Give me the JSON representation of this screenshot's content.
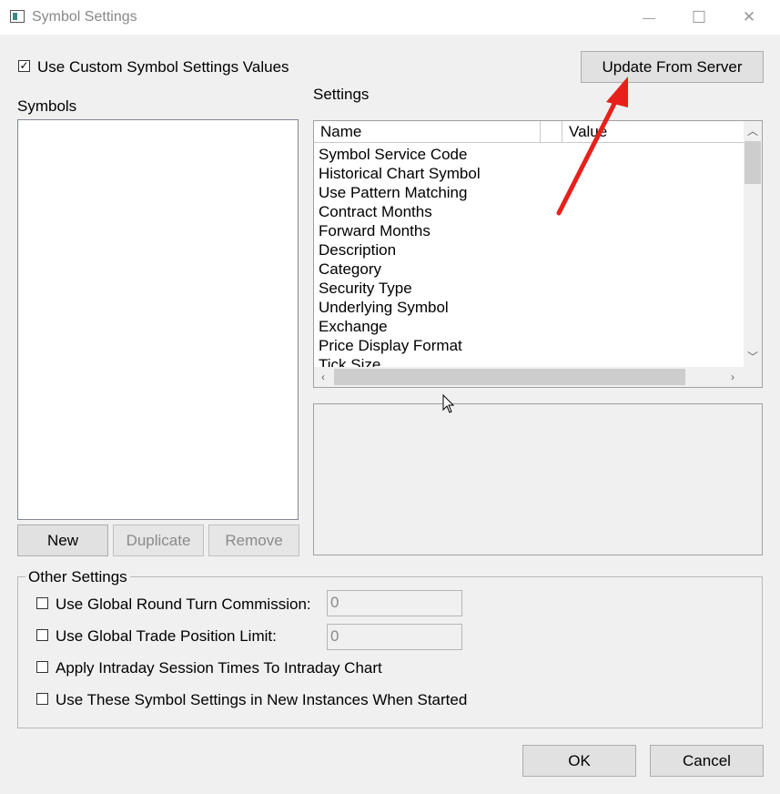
{
  "window": {
    "title": "Symbol Settings",
    "minimize_glyph": "—",
    "maximize_glyph": "☐",
    "close_glyph": "✕"
  },
  "use_custom": {
    "label": "Use Custom Symbol Settings Values",
    "checked": true,
    "mark": "✓"
  },
  "update_button": "Update From Server",
  "symbols": {
    "heading": "Symbols",
    "items": [],
    "buttons": {
      "new": "New",
      "duplicate": "Duplicate",
      "remove": "Remove"
    }
  },
  "settings": {
    "heading": "Settings",
    "columns": {
      "name": "Name",
      "value": "Value"
    },
    "rows": [
      "Symbol Service Code",
      "Historical Chart Symbol",
      "Use Pattern Matching",
      "Contract Months",
      "Forward Months",
      "Description",
      "Category",
      "Security Type",
      "Underlying Symbol",
      "Exchange",
      "Price Display Format",
      "Tick Size"
    ],
    "scroll": {
      "up": "︿",
      "down": "﹀",
      "left": "‹",
      "right": "›"
    }
  },
  "other_settings": {
    "legend": "Other Settings",
    "round_turn_commission": {
      "label": "Use Global Round Turn Commission:",
      "value": "0",
      "checked": false
    },
    "trade_position_limit": {
      "label": "Use Global Trade Position Limit:",
      "value": "0",
      "checked": false
    },
    "intraday_session": {
      "label": "Apply Intraday Session Times To Intraday Chart",
      "checked": false
    },
    "new_instances": {
      "label": "Use These Symbol Settings in New Instances When Started",
      "checked": false
    }
  },
  "footer": {
    "ok": "OK",
    "cancel": "Cancel"
  },
  "colors": {
    "annotation_arrow": "#e8201c",
    "selection": "#3a8a8a"
  },
  "icons": [
    "app-icon",
    "minimize-icon",
    "maximize-icon",
    "close-icon",
    "check-icon",
    "red-arrow-annotation",
    "mouse-cursor-icon"
  ]
}
